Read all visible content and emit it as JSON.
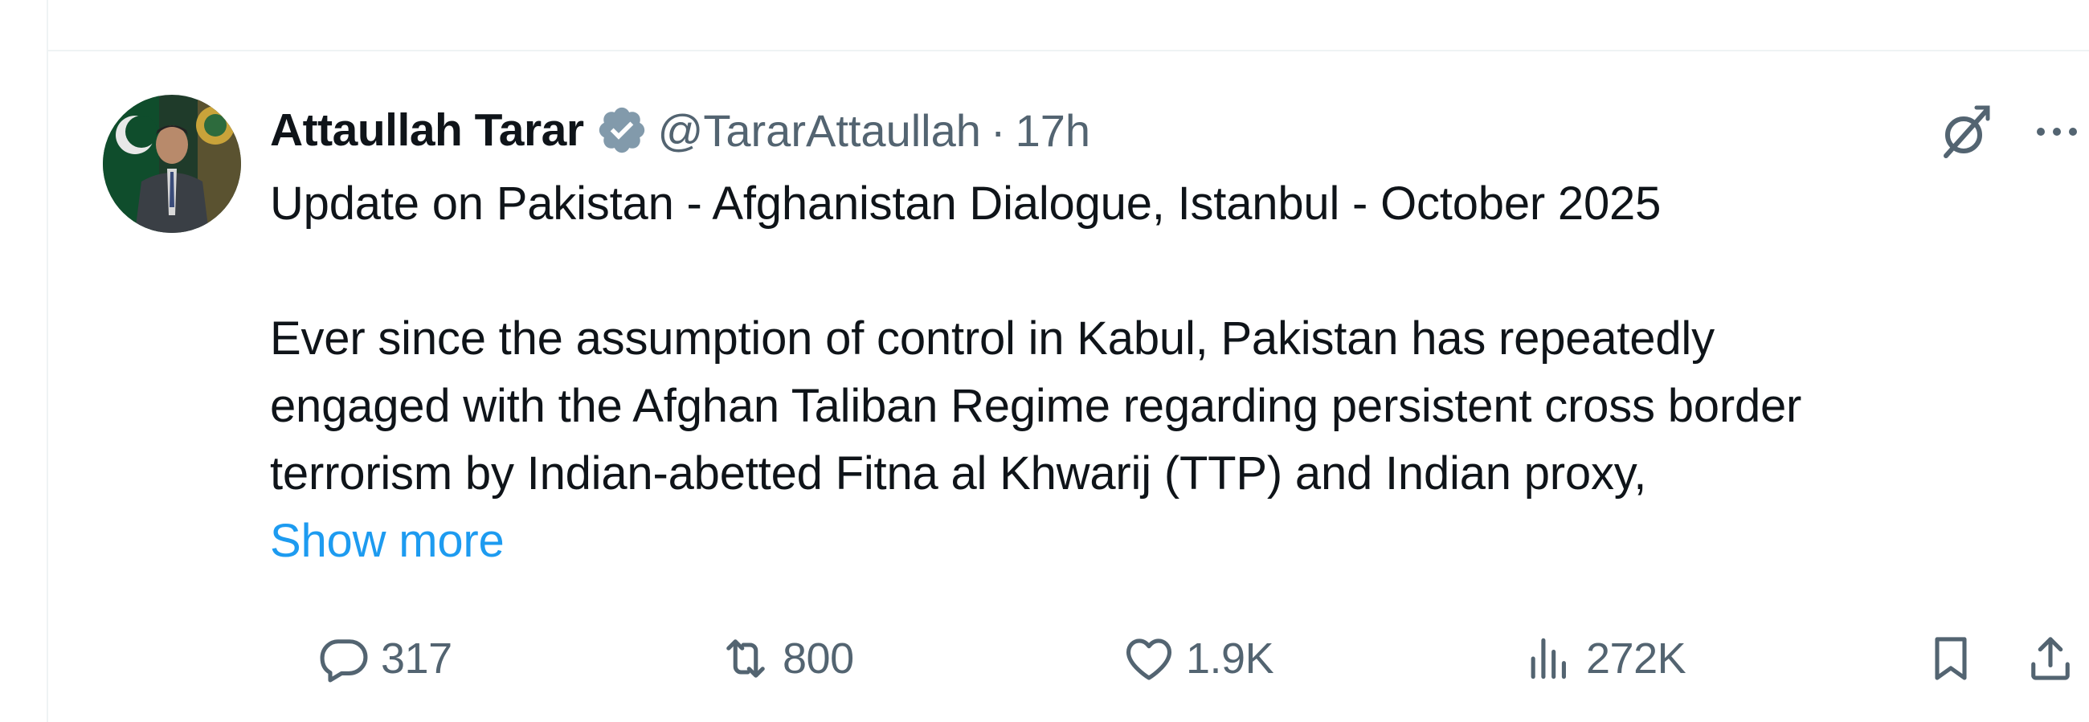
{
  "post": {
    "author": {
      "display_name": "Attaullah Tarar",
      "handle": "@TararAttaullah",
      "verified_icon": "verified-badge-icon"
    },
    "separator": "·",
    "time": "17h",
    "text": {
      "line1": "Update on Pakistan - Afghanistan Dialogue, Istanbul - October 2025",
      "line2": "Ever since the assumption of control in Kabul, Pakistan has repeatedly",
      "line3": "engaged with the Afghan Taliban Regime regarding persistent cross border",
      "line4": "terrorism by Indian-abetted Fitna al Khwarij (TTP) and Indian proxy,"
    },
    "show_more_label": "Show more",
    "actions": {
      "replies": "317",
      "reposts": "800",
      "likes": "1.9K",
      "views": "272K"
    }
  },
  "colors": {
    "text": "#0f1419",
    "secondary": "#536471",
    "link": "#1d9bf0",
    "border": "#eff3f4"
  }
}
